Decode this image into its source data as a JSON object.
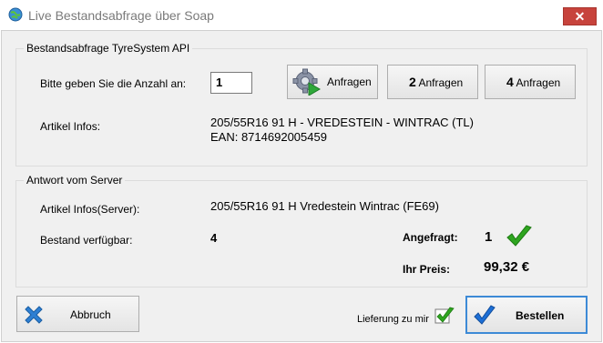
{
  "window": {
    "title": "Live Bestandsabfrage über Soap",
    "close_label": "✕"
  },
  "query_group": {
    "legend": "Bestandsabfrage TyreSystem API",
    "quantity_label": "Bitte geben Sie die Anzahl an:",
    "quantity_value": "1",
    "request_button": "Anfragen",
    "request2_num": "2",
    "request2_label": "Anfragen",
    "request4_num": "4",
    "request4_label": "Anfragen",
    "article_label": "Artikel Infos:",
    "article_line1": "205/55R16 91 H - VREDESTEIN - WINTRAC (TL)",
    "article_line2": "EAN: 8714692005459"
  },
  "response_group": {
    "legend": "Antwort vom Server",
    "article_label": "Artikel Infos(Server):",
    "article_value": "205/55R16 91 H Vredestein Wintrac  (FE69)",
    "stock_label": "Bestand verfügbar:",
    "stock_value": "4",
    "requested_label": "Angefragt:",
    "requested_value": "1",
    "price_label": "Ihr Preis:",
    "price_value": "99,32 €"
  },
  "footer": {
    "cancel_button": "Abbruch",
    "delivery_label": "Lieferung zu mir",
    "order_button": "Bestellen"
  },
  "colors": {
    "accent_green": "#2ea51f",
    "close_red": "#c7433c",
    "check_blue": "#1d6fd6",
    "cross_blue": "#2d7fd3"
  }
}
